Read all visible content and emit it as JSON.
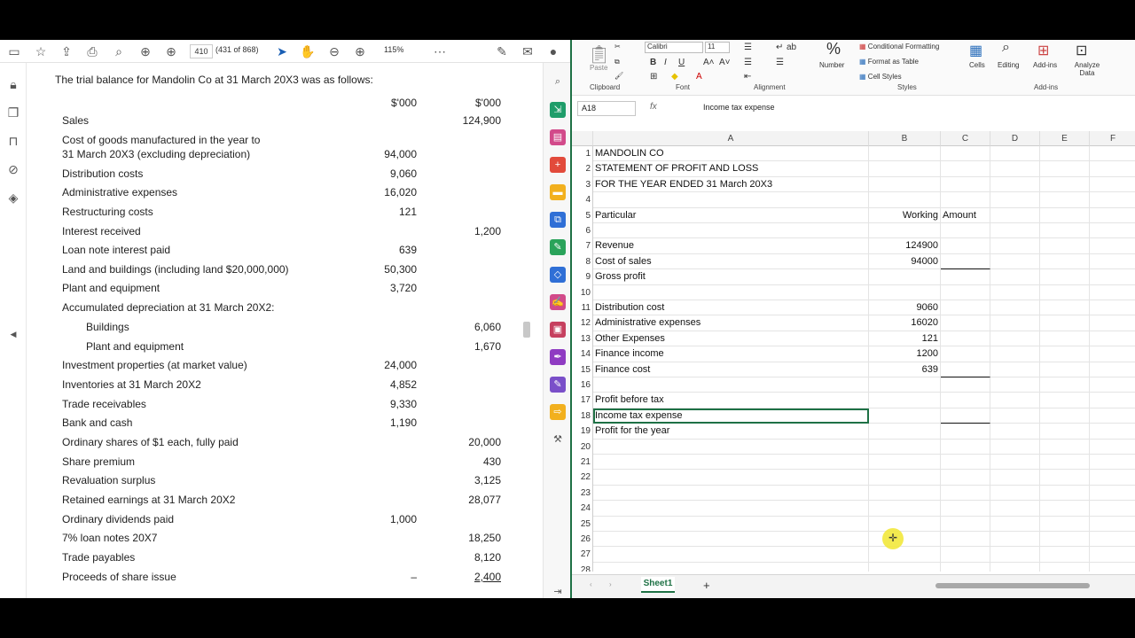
{
  "pdf": {
    "toolbar": {
      "page_input": "410",
      "page_count": "(431 of 868)",
      "zoom": "115%"
    },
    "intro": "The trial balance for Mandolin Co at 31 March 20X3 was as follows:",
    "header_debit": "$'000",
    "header_credit": "$'000",
    "rows": [
      {
        "label": "Sales",
        "debit": "",
        "credit": "124,900"
      },
      {
        "label": "Cost of goods manufactured in the year to",
        "debit": "",
        "credit": ""
      },
      {
        "label": " 31 March 20X3 (excluding depreciation)",
        "debit": "94,000",
        "credit": ""
      },
      {
        "label": "Distribution costs",
        "debit": "9,060",
        "credit": ""
      },
      {
        "label": "Administrative expenses",
        "debit": "16,020",
        "credit": ""
      },
      {
        "label": "Restructuring costs",
        "debit": "121",
        "credit": ""
      },
      {
        "label": "Interest received",
        "debit": "",
        "credit": "1,200"
      },
      {
        "label": "Loan note interest paid",
        "debit": "639",
        "credit": ""
      },
      {
        "label": "Land and buildings (including land $20,000,000)",
        "debit": "50,300",
        "credit": ""
      },
      {
        "label": "Plant and equipment",
        "debit": "3,720",
        "credit": ""
      },
      {
        "label": "Accumulated depreciation at 31 March 20X2:",
        "debit": "",
        "credit": ""
      },
      {
        "label": "Buildings",
        "debit": "",
        "credit": "6,060",
        "indent": true
      },
      {
        "label": "Plant and equipment",
        "debit": "",
        "credit": "1,670",
        "indent": true
      },
      {
        "label": "Investment properties (at market value)",
        "debit": "24,000",
        "credit": ""
      },
      {
        "label": "Inventories at 31 March 20X2",
        "debit": "4,852",
        "credit": ""
      },
      {
        "label": "Trade receivables",
        "debit": "9,330",
        "credit": ""
      },
      {
        "label": "Bank and cash",
        "debit": "1,190",
        "credit": ""
      },
      {
        "label": "Ordinary shares of $1 each, fully paid",
        "debit": "",
        "credit": "20,000"
      },
      {
        "label": "Share premium",
        "debit": "",
        "credit": "430"
      },
      {
        "label": "Revaluation surplus",
        "debit": "",
        "credit": "3,125"
      },
      {
        "label": "Retained earnings at 31 March 20X2",
        "debit": "",
        "credit": "28,077"
      },
      {
        "label": "Ordinary dividends paid",
        "debit": "1,000",
        "credit": ""
      },
      {
        "label": "7% loan notes 20X7",
        "debit": "",
        "credit": "18,250"
      },
      {
        "label": "Trade payables",
        "debit": "",
        "credit": "8,120"
      },
      {
        "label": "Proceeds of share issue",
        "debit": "–",
        "credit": "2,400"
      }
    ]
  },
  "excel": {
    "ribbon": {
      "clipboard": "Clipboard",
      "paste": "Paste",
      "font": "Font",
      "font_name": "Calibri",
      "font_size": "11",
      "alignment": "Alignment",
      "number": "Number",
      "styles": "Styles",
      "conditional": "Conditional Formatting",
      "format_table": "Format as Table",
      "cell_styles": "Cell Styles",
      "cells": "Cells",
      "editing": "Editing",
      "addins": "Add-ins",
      "addins_group": "Add-ins",
      "analyze": "Analyze Data"
    },
    "namebox": "A18",
    "fx": "fx",
    "formula": "Income tax expense",
    "columns": [
      "A",
      "B",
      "C",
      "D",
      "E",
      "F"
    ],
    "rows": [
      {
        "n": "1",
        "a": "MANDOLIN CO",
        "b": "",
        "c": ""
      },
      {
        "n": "2",
        "a": "STATEMENT OF PROFIT AND LOSS",
        "b": "",
        "c": ""
      },
      {
        "n": "3",
        "a": "FOR THE YEAR ENDED 31 March 20X3",
        "b": "",
        "c": ""
      },
      {
        "n": "4",
        "a": "",
        "b": "",
        "c": ""
      },
      {
        "n": "5",
        "a": "Particular",
        "b": "Working",
        "c": "Amount"
      },
      {
        "n": "6",
        "a": "",
        "b": "",
        "c": ""
      },
      {
        "n": "7",
        "a": "Revenue",
        "b": "124900",
        "c": ""
      },
      {
        "n": "8",
        "a": "Cost of sales",
        "b": "94000",
        "c": ""
      },
      {
        "n": "9",
        "a": "Gross profit",
        "b": "",
        "c": ""
      },
      {
        "n": "10",
        "a": "",
        "b": "",
        "c": ""
      },
      {
        "n": "11",
        "a": "Distribution cost",
        "b": "9060",
        "c": ""
      },
      {
        "n": "12",
        "a": "Administrative expenses",
        "b": "16020",
        "c": ""
      },
      {
        "n": "13",
        "a": "Other Expenses",
        "b": "121",
        "c": ""
      },
      {
        "n": "14",
        "a": "Finance income",
        "b": "1200",
        "c": ""
      },
      {
        "n": "15",
        "a": "Finance cost",
        "b": "639",
        "c": ""
      },
      {
        "n": "16",
        "a": "",
        "b": "",
        "c": ""
      },
      {
        "n": "17",
        "a": "Profit before tax",
        "b": "",
        "c": ""
      },
      {
        "n": "18",
        "a": "Income tax expense",
        "b": "",
        "c": ""
      },
      {
        "n": "19",
        "a": "Profit for the year",
        "b": "",
        "c": ""
      },
      {
        "n": "20",
        "a": "",
        "b": "",
        "c": ""
      },
      {
        "n": "21",
        "a": "",
        "b": "",
        "c": ""
      },
      {
        "n": "22",
        "a": "",
        "b": "",
        "c": ""
      },
      {
        "n": "23",
        "a": "",
        "b": "",
        "c": ""
      },
      {
        "n": "24",
        "a": "",
        "b": "",
        "c": ""
      },
      {
        "n": "25",
        "a": "",
        "b": "",
        "c": ""
      },
      {
        "n": "26",
        "a": "",
        "b": "",
        "c": ""
      },
      {
        "n": "27",
        "a": "",
        "b": "",
        "c": ""
      },
      {
        "n": "28",
        "a": "",
        "b": "",
        "c": ""
      }
    ],
    "sheet_tab": "Sheet1"
  }
}
